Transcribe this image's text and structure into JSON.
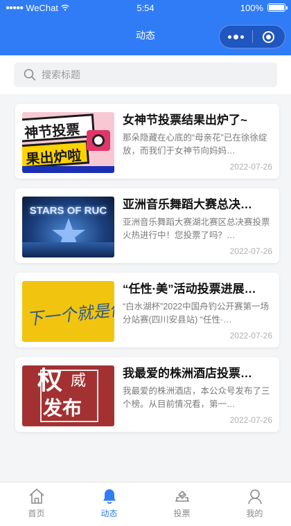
{
  "status": {
    "carrier": "WeChat",
    "time": "5:54",
    "battery": "100%",
    "battery_level": 1.0
  },
  "nav": {
    "title": "动态"
  },
  "search": {
    "placeholder": "搜索标题",
    "value": ""
  },
  "articles": [
    {
      "title": "女神节投票结果出炉了~",
      "desc": "那朵隐藏在心底的“母亲花”已在徐徐绽放，而我们于女神节向妈妈…",
      "date": "2022-07-26",
      "thumb_text_1": "神节投票",
      "thumb_text_2": "果出炉啦"
    },
    {
      "title": "亚洲音乐舞蹈大赛总决…",
      "desc": "亚洲音乐舞蹈大赛湖北赛区总决赛投票火热进行中！您投票了吗？…",
      "date": "2022-07-26",
      "thumb_text_1": "STARS OF RUC"
    },
    {
      "title": "“任性·美”活动投票进展…",
      "desc": "“白水湖杯”2022中国舟钓公开赛第一场分站赛(四川安县站) “任性·…",
      "date": "2022-07-26",
      "thumb_text_1": "下一个就是你"
    },
    {
      "title": "我最爱的株洲酒店投票…",
      "desc": "我最爱的株洲酒店，本公众号发布了三个榜。从目前情况看，第一…",
      "date": "2022-07-26",
      "thumb_text_1": "权",
      "thumb_text_2": "威",
      "thumb_text_3": "发布"
    }
  ],
  "tabs": [
    {
      "label": "首页",
      "icon": "home-icon",
      "active": false
    },
    {
      "label": "动态",
      "icon": "bell-icon",
      "active": true
    },
    {
      "label": "投票",
      "icon": "vote-icon",
      "active": false
    },
    {
      "label": "我的",
      "icon": "user-icon",
      "active": false
    }
  ],
  "colors": {
    "primary": "#2f7cf6",
    "inactive": "#8a8a8a"
  }
}
